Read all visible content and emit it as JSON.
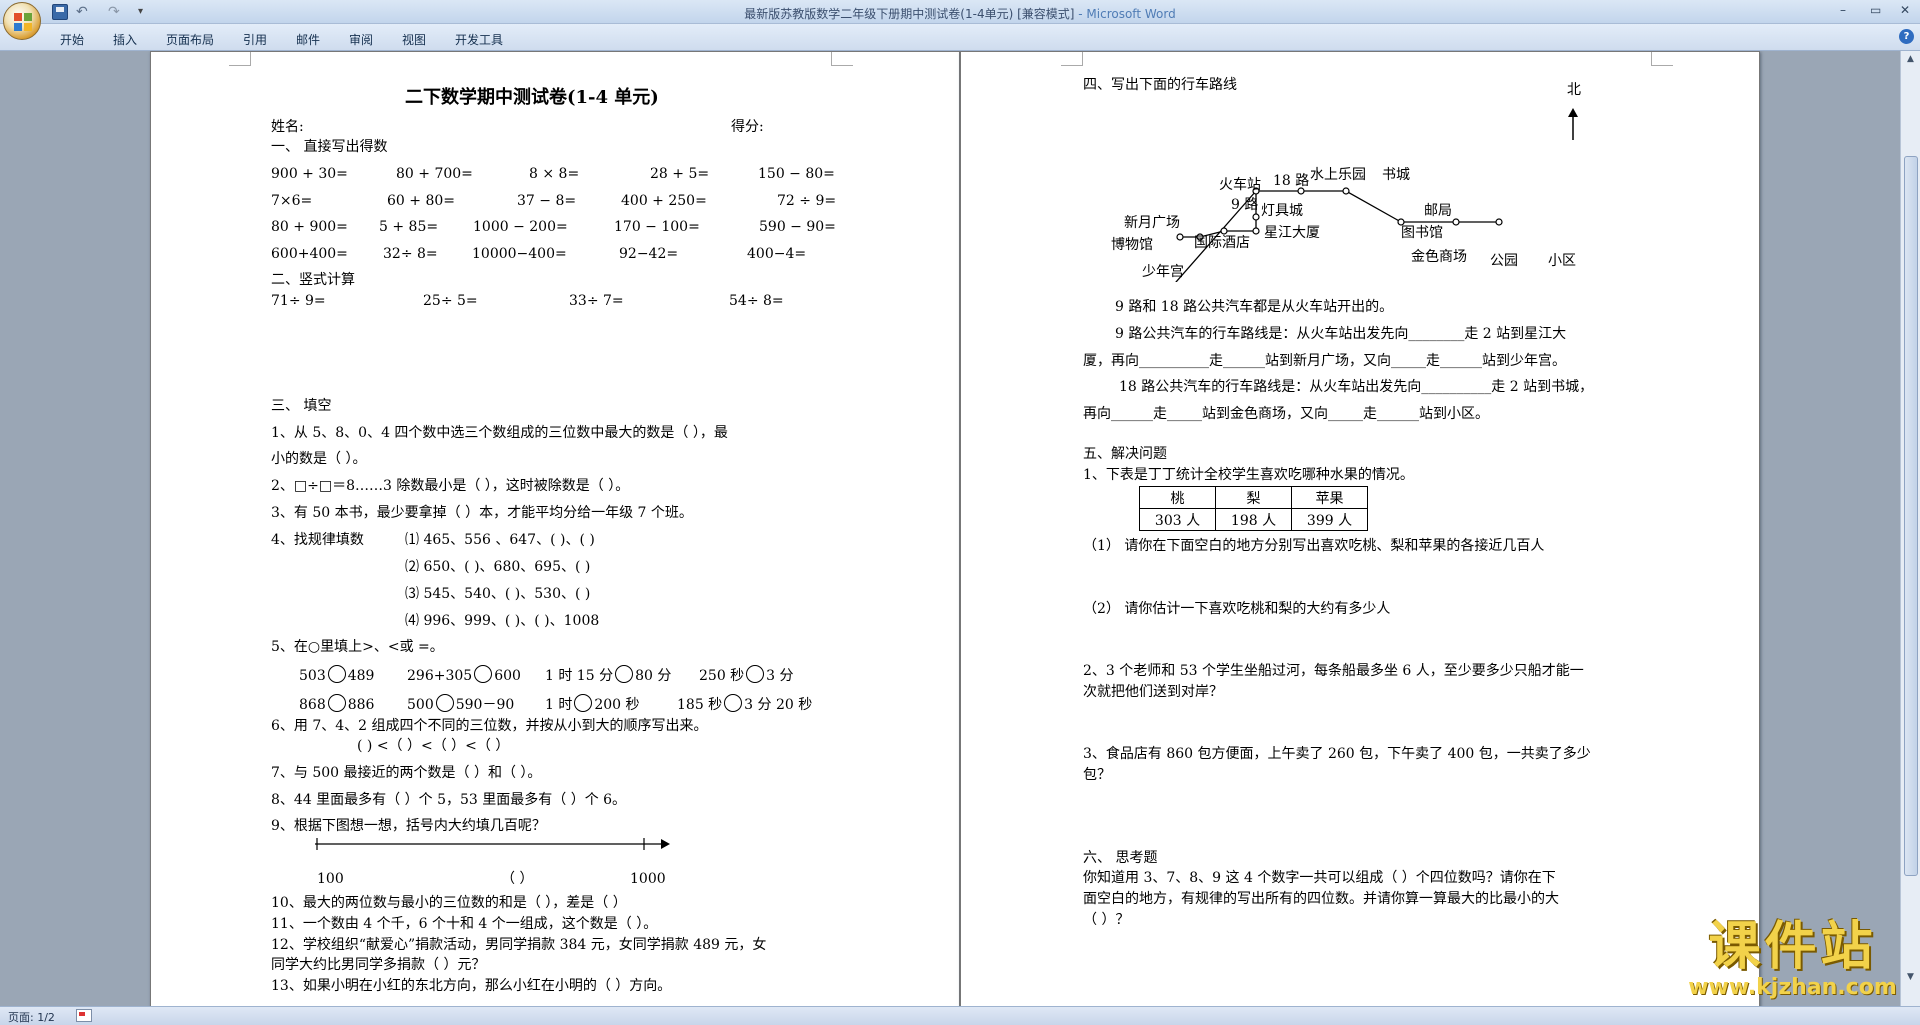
{
  "window": {
    "title": "最新版苏教版数学二年级下册期中测试卷(1-4单元) [兼容模式]",
    "app_name": " - Microsoft Word",
    "minimize": "–",
    "maximize": "▭",
    "close": "✕"
  },
  "quick_access": {
    "undo": "↶",
    "redo": "↷",
    "more": "▾"
  },
  "ribbon": {
    "tabs": [
      "开始",
      "插入",
      "页面布局",
      "引用",
      "邮件",
      "审阅",
      "视图",
      "开发工具"
    ],
    "help": "?"
  },
  "status": {
    "page": "页面: 1/2"
  },
  "watermark": {
    "text": "课件站",
    "url": "www.kjzhan.com"
  },
  "page1": {
    "title": "二下数学期中测试卷(1-4 单元)",
    "name_label": "姓名:",
    "score_label": "得分:",
    "sec1": "一、     直接写出得数",
    "oral": [
      [
        "900 + 30=",
        "80 + 700=",
        "8 × 8=",
        "28 + 5=",
        "150 − 80="
      ],
      [
        "7×6=",
        "60 + 80=",
        "37 − 8=",
        "400 + 250=",
        "72 ÷ 9="
      ],
      [
        "80 + 900=",
        "5 + 85=",
        "1000 − 200=",
        "170 − 100=",
        "590 − 90="
      ],
      [
        "600+400=",
        "32÷ 8=",
        "10000−400=",
        "92−42=",
        "400−4="
      ]
    ],
    "sec2": "二、竖式计算",
    "vertical": [
      "71÷ 9=",
      "25÷ 5=",
      "33÷ 7=",
      "54÷ 8="
    ],
    "sec3": "三、     填空",
    "q1a": "1、从 5、8、0、4 四个数中选三个数组成的三位数中最大的数是（          ），最",
    "q1b": "小的数是（        ）。",
    "q2": "2、□÷□＝8……3 除数最小是（     ），这时被除数是（     ）。",
    "q3": "3、有 50 本书，最少要拿掉（   ）本，才能平均分给一年级 7 个班。",
    "q4": "4、找规律填数",
    "q4_items": [
      "⑴ 465、556 、647、(       )、(       )",
      "⑵ 650、(        )、680、695、(        )",
      "⑶ 545、540、(        )、530、(        )",
      "⑷ 996、999、(        )、(       )、1008"
    ],
    "q5": "5、在○里填上>、<或 =。",
    "q5_row1": [
      [
        "503",
        "489"
      ],
      [
        "296+305",
        "600"
      ],
      [
        "1 时 15 分",
        "80 分"
      ],
      [
        "250 秒",
        "3 分"
      ]
    ],
    "q5_row2": [
      [
        "868",
        "886"
      ],
      [
        "500",
        "590－90"
      ],
      [
        "1 时",
        "200 秒"
      ],
      [
        "185 秒",
        "3 分 20 秒"
      ]
    ],
    "q6a": "6、用 7、4、2 组成四个不同的三位数，并按从小到大的顺序写出来。",
    "q6b": "(            ) <（           ）<（          ）<（          ）",
    "q7": "7、与 500 最接近的两个数是（       ）和（       ）。",
    "q8": "8、44 里面最多有（     ）个 5，53 里面最多有（           ）个 6。",
    "q9": "9、根据下图想一想，括号内大约填几百呢？",
    "nl_start": "100",
    "nl_mid": "（          ）",
    "nl_end": "1000",
    "q10": "10、最大的两位数与最小的三位数的和是（        ），差是（         ）",
    "q11": "11、一个数由 4 个千，6 个十和 4 个一组成，这个数是（            ）。",
    "q12a": "12、学校组织“献爱心”捐款活动，男同学捐款 384 元，女同学捐款 489 元，女",
    "q12b": "同学大约比男同学多捐款（         ）元？",
    "q13": "13、如果小明在小红的东北方向，那么小红在小明的（        ）方向。"
  },
  "page2": {
    "sec4": "四、写出下面的行车路线",
    "north": "北",
    "map_labels": {
      "huochezhan": "火车站",
      "r18": "18 路",
      "shuishang": "水上乐园",
      "shucheng": "书城",
      "r9": "9 路",
      "dengju": "灯具城",
      "youju": "邮局",
      "xinyue": "新月广场",
      "bowuguan": "博物馆",
      "guoji": "国际酒店",
      "xingjiang": "星江大厦",
      "tushuguan": "图书馆",
      "jinse": "金色商场",
      "gongyuan": "公园",
      "xiaoqu": "小区",
      "shaonian": "少年宫"
    },
    "r1": "9 路和 18 路公共汽车都是从火车站开出的。",
    "r2a": "9 路公共汽车的行车路线是：从火车站出发先向________走 2 站到星江大",
    "r2b": "厦，再向__________走______站到新月广场，又向_____走______站到少年宫。",
    "r3a": "18 路公共汽车的行车路线是：从火车站出发先向__________走 2 站到书城，",
    "r3b": "再向______走_____站到金色商场，又向_____走______站到小区。",
    "sec5": "五、解决问题",
    "p1": "1、下表是丁丁统计全校学生喜欢吃哪种水果的情况。",
    "table_head": [
      "桃",
      "梨",
      "苹果"
    ],
    "table_vals": [
      "303 人",
      "198 人",
      "399 人"
    ],
    "p1_1": "（1）  请你在下面空白的地方分别写出喜欢吃桃、梨和苹果的各接近几百人",
    "p1_2": "（2）  请你估计一下喜欢吃桃和梨的大约有多少人",
    "p2a": "2、3 个老师和 53 个学生坐船过河，每条船最多坐 6 人，至少要多少只船才能一",
    "p2b": "次就把他们送到对岸？",
    "p3a": "3、食品店有 860 包方便面，上午卖了 260 包，下午卖了 400 包，一共卖了多少",
    "p3b": "包？",
    "sec6": "六、     思考题",
    "t1": "你知道用 3、7、8、9 这 4 个数字一共可以组成（         ）个四位数吗？请你在下",
    "t2": "面空白的地方，有规律的写出所有的四位数。并请你算一算最大的比最小的大",
    "t3": "（         ）？"
  }
}
